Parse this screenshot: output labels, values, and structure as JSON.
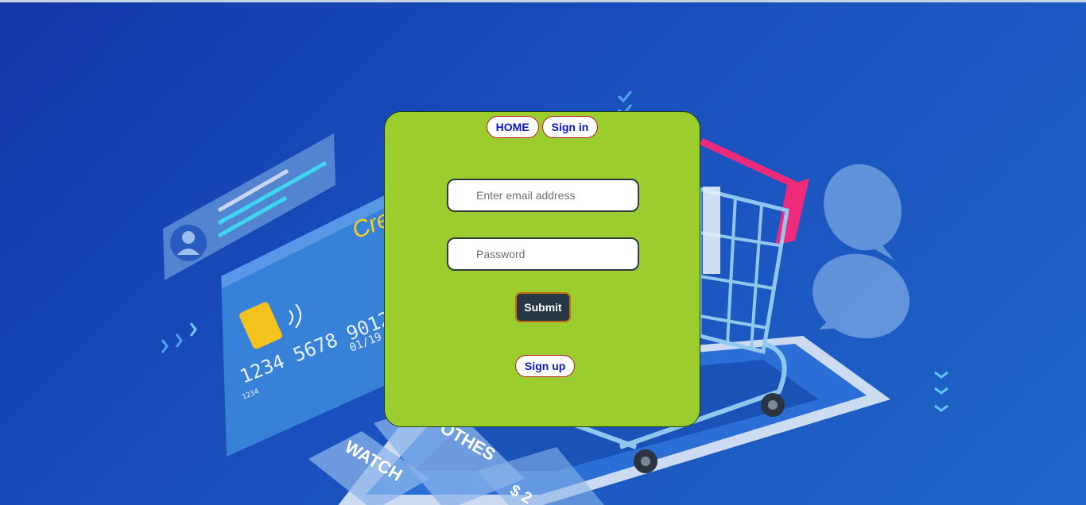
{
  "nav": {
    "home_label": "HOME",
    "signin_label": "Sign in"
  },
  "form": {
    "email_placeholder": "Enter email address",
    "password_placeholder": "Password",
    "submit_label": "Submit",
    "signup_label": "Sign up"
  },
  "background": {
    "card_text": "Cre",
    "card_number": "1234 5678 9012",
    "card_small": "1234",
    "card_expiry": "01/19",
    "tile_watch": "WATCH",
    "tile_clothes": "OTHES",
    "tile_price": "$ 2",
    "illustration": "online-shopping-illustration"
  },
  "colors": {
    "panel": "#9acd2d",
    "pill_border": "#c0141a",
    "pill_text": "#0b14c7",
    "submit_bg": "#263845",
    "submit_border": "#c76b14",
    "cart_handle": "#ee2a7b"
  }
}
